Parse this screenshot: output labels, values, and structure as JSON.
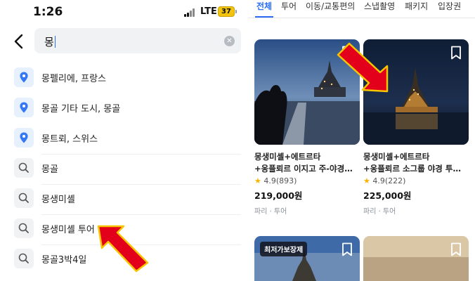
{
  "status_bar": {
    "time": "1:26",
    "network": "LTE",
    "battery": "37"
  },
  "search": {
    "query": "몽",
    "clear_icon": "clear-icon"
  },
  "suggestions": [
    {
      "type": "location",
      "icon": "location-pin-icon",
      "label": "몽펠리에, 프랑스"
    },
    {
      "type": "location",
      "icon": "location-pin-icon",
      "label": "몽골 기타 도시, 몽골"
    },
    {
      "type": "location",
      "icon": "location-pin-icon",
      "label": "몽트뢰, 스위스"
    },
    {
      "type": "search",
      "icon": "search-icon",
      "label": "몽골"
    },
    {
      "type": "search",
      "icon": "search-icon",
      "label": "몽생미셸"
    },
    {
      "type": "search",
      "icon": "search-icon",
      "label": "몽생미셸 투어"
    },
    {
      "type": "search",
      "icon": "search-icon",
      "label": "몽골3박4일"
    }
  ],
  "tabs": [
    "전체",
    "투어",
    "이동/교통편의",
    "스냅촬영",
    "패키지",
    "입장권"
  ],
  "active_tab": "전체",
  "products": [
    {
      "title_line1": "몽생미셸+에트르타",
      "title_line2": "+옹플뢰르 이지고 주-야경…",
      "rating": "4.9",
      "reviews": "(893)",
      "price": "219,000원",
      "meta": "파리 · 투어"
    },
    {
      "title_line1": "몽생미셸+에트르타",
      "title_line2": "+옹플뢰르 소그룹 야경 투…",
      "rating": "4.9",
      "reviews": "(222)",
      "price": "225,000원",
      "meta": "파리 · 투어"
    }
  ],
  "partial_products": [
    {
      "badge": "최저가보장제"
    },
    {
      "badge": ""
    }
  ],
  "colors": {
    "accent": "#2b6ef5",
    "arrow": "#e3001b",
    "arrow_outline": "#f7c600",
    "star": "#f7b500"
  }
}
